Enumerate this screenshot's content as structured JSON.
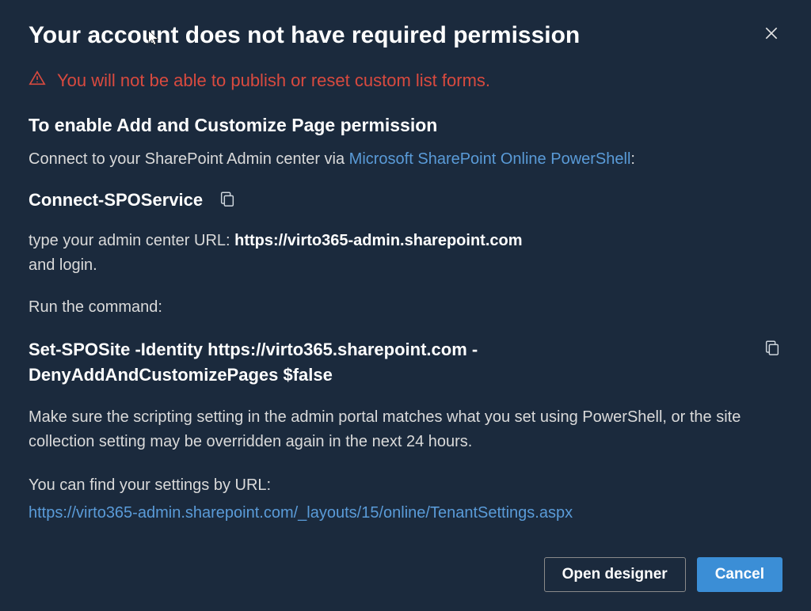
{
  "dialog": {
    "title": "Your account does not have required permission",
    "warning": "You will not be able to publish or reset custom list forms.",
    "subtitle": "To enable Add and Customize Page permission",
    "connect_prefix": "Connect to your SharePoint Admin center via ",
    "connect_link": "Microsoft SharePoint Online PowerShell",
    "connect_suffix": ":",
    "command1": "Connect-SPOService",
    "type_url_prefix": "type your admin center URL: ",
    "admin_url": "https://virto365-admin.sharepoint.com",
    "and_login": "and login.",
    "run_command": "Run the command:",
    "command2": "Set-SPOSite -Identity https://virto365.sharepoint.com -DenyAddAndCustomizePages $false",
    "note": "Make sure the scripting setting in the admin portal matches what you set using PowerShell, or the site collection setting may be overridden again in the next 24 hours.",
    "settings_label": "You can find your settings by URL:",
    "settings_url": "https://virto365-admin.sharepoint.com/_layouts/15/online/TenantSettings.aspx"
  },
  "buttons": {
    "open_designer": "Open designer",
    "cancel": "Cancel"
  }
}
